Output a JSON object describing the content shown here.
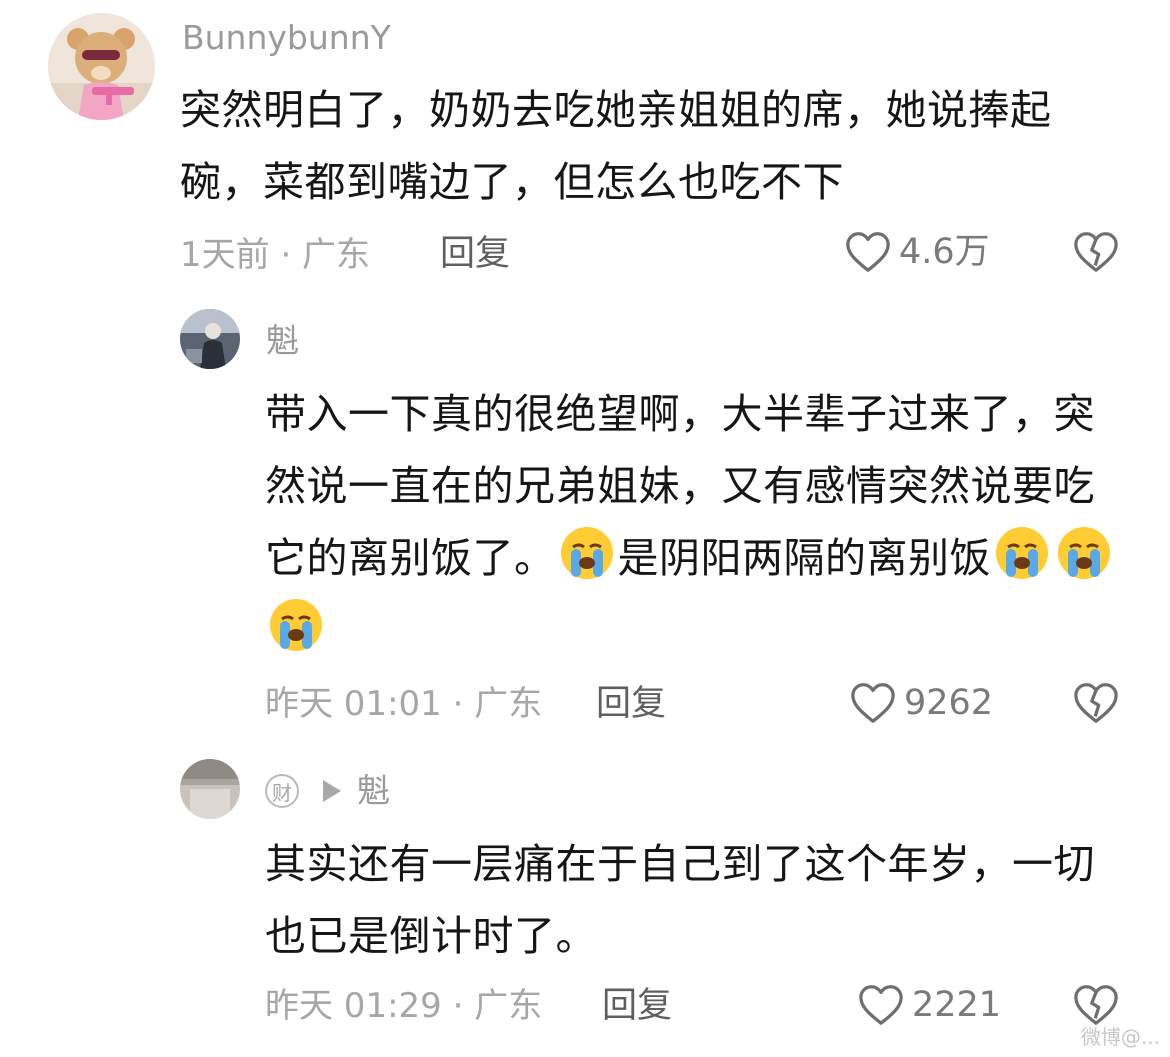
{
  "comments": [
    {
      "username": "BunnybunnY",
      "text": "突然明白了，奶奶去吃她亲姐姐的席，她说捧起碗，菜都到嘴边了，但怎么也吃不下",
      "time_location": "1天前 · 广东",
      "reply_label": "回复",
      "likes": "4.6万"
    },
    {
      "username": "魁",
      "text_before_emoji": "带入一下真的很绝望啊，大半辈子过来了，突然说一直在的兄弟姐妹，又有感情突然说要吃它的离别饭了。",
      "text_after_emoji": "是阴阳两隔的离别饭",
      "time_location": "昨天 01:01 · 广东",
      "reply_label": "回复",
      "likes": "9262"
    },
    {
      "badge": "财",
      "reply_to": "魁",
      "text": "其实还有一层痛在于自己到了这个年岁，一切也已是倒计时了。",
      "time_location": "昨天 01:29 · 广东",
      "reply_label": "回复",
      "likes": "2221"
    }
  ],
  "icons": {
    "like": "heart-outline-icon",
    "dislike": "broken-heart-icon",
    "emoji": "loudly-crying-face-emoji"
  },
  "watermark": "微博@...",
  "colors": {
    "text": "#161616",
    "meta": "#a6a6a6",
    "reply": "#5f5f5f",
    "icon": "#6e6e6e"
  }
}
